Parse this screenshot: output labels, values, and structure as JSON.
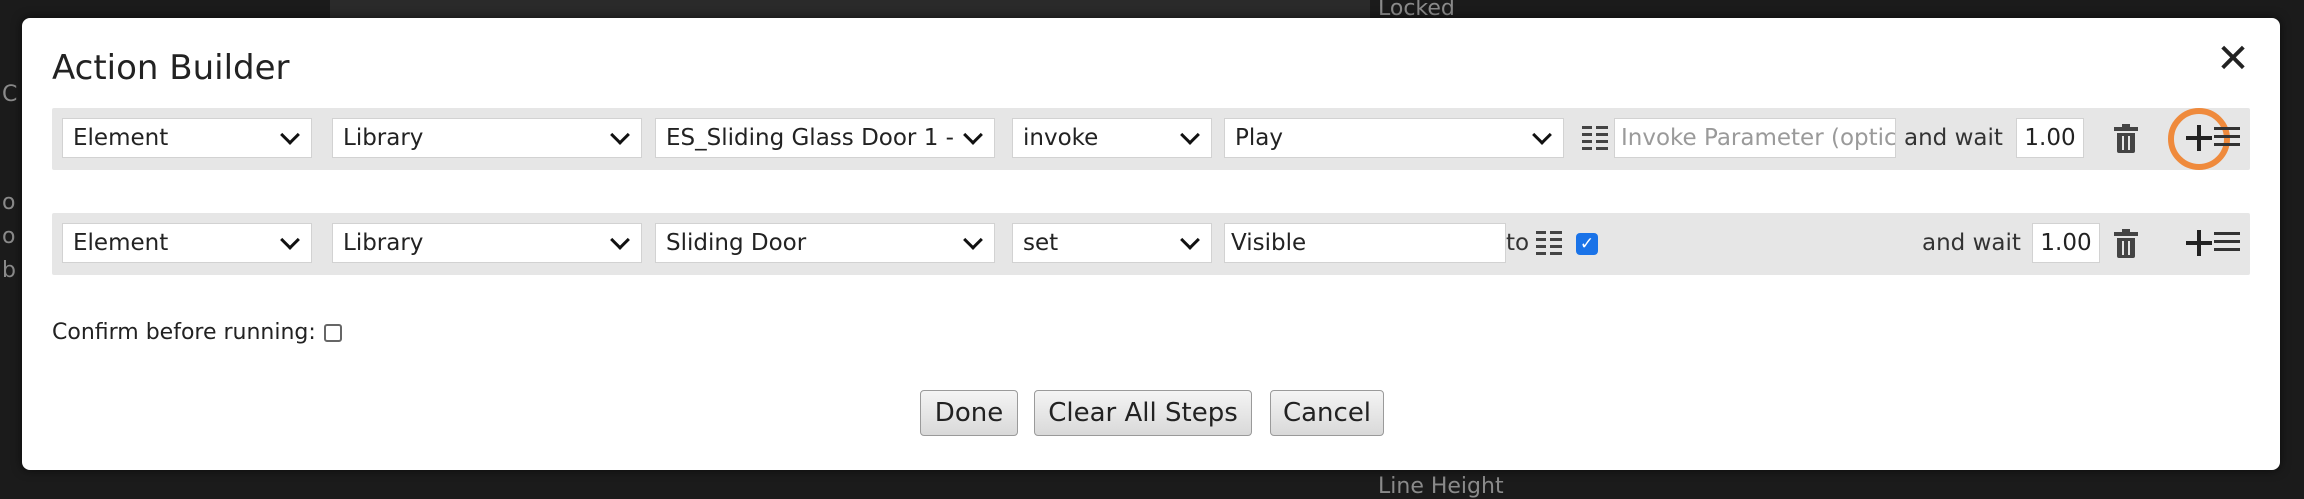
{
  "background": {
    "label_top": "Locked",
    "label_bottom": "Line Height",
    "left_glyphs": [
      "C",
      "o",
      "o",
      "b"
    ]
  },
  "dialog": {
    "title": "Action Builder",
    "close_glyph": "✕",
    "steps": [
      {
        "target_type": "Element",
        "source": "Library",
        "object": "ES_Sliding Glass Door 1 -",
        "action": "invoke",
        "member": "Play",
        "param_placeholder": "Invoke Parameter (optic",
        "wait_label": "and wait",
        "wait_value": "1.00"
      },
      {
        "target_type": "Element",
        "source": "Library",
        "object": "Sliding Door",
        "action": "set",
        "member": "Visible",
        "to_label": "to",
        "checked": true,
        "wait_label": "and wait",
        "wait_value": "1.00"
      }
    ],
    "confirm_label": "Confirm before running:",
    "buttons": {
      "done": "Done",
      "clear": "Clear All Steps",
      "cancel": "Cancel"
    }
  },
  "colors": {
    "highlight": "#ef8a3c",
    "checkbox": "#1a73e8"
  }
}
